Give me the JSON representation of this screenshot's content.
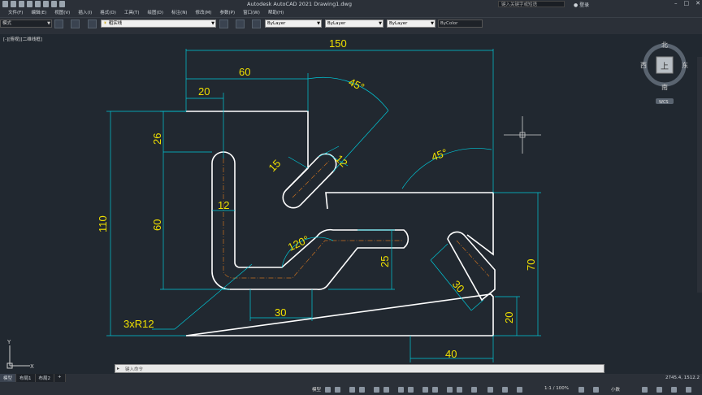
{
  "titlebar": {
    "app_title": "Autodesk AutoCAD 2021    Drawing1.dwg",
    "search_placeholder": "键入关键字或短语",
    "user": "登录"
  },
  "menu": [
    "文件(F)",
    "编辑(E)",
    "视图(V)",
    "插入(I)",
    "格式(O)",
    "工具(T)",
    "绘图(D)",
    "标注(N)",
    "修改(M)",
    "参数(P)",
    "窗口(W)",
    "帮助(H)"
  ],
  "toolbar": {
    "workspace": "模式",
    "layer": "粗实线",
    "color": "ByLayer",
    "linetype": "ByLayer",
    "lineweight": "ByLayer",
    "plotstyle": "ByColor"
  },
  "viewport_label": "[-][俯视][二维线框]",
  "viewcube": {
    "north": "北",
    "south": "南",
    "east": "东",
    "west": "西",
    "top": "上",
    "wcs": "WCS"
  },
  "drawing": {
    "dims": {
      "d150": "150",
      "d60": "60",
      "d20": "20",
      "d45a": "45°",
      "d26": "26",
      "d110": "110",
      "d60v": "60",
      "d12": "12",
      "d15": "15",
      "d12s": "12",
      "d45b": "45°",
      "d120": "120°",
      "d25": "25",
      "d70": "70",
      "d30b": "30",
      "d30s": "30",
      "d20b": "20",
      "d40": "40",
      "r12": "3xR12"
    },
    "colors": {
      "dim": "#00c8d8",
      "text": "#f0e000",
      "outline": "#ffffff",
      "center": "#c87020",
      "background": "#212830"
    }
  },
  "ucs": {
    "x": "X",
    "y": "Y"
  },
  "command": {
    "placeholder": "键入命令"
  },
  "layout_tabs": [
    "模型",
    "布局1",
    "布局2"
  ],
  "status": {
    "mode": "模型",
    "scale": "1:1 / 100%",
    "units": "小数",
    "coords": "2745.4, 1512.2"
  }
}
